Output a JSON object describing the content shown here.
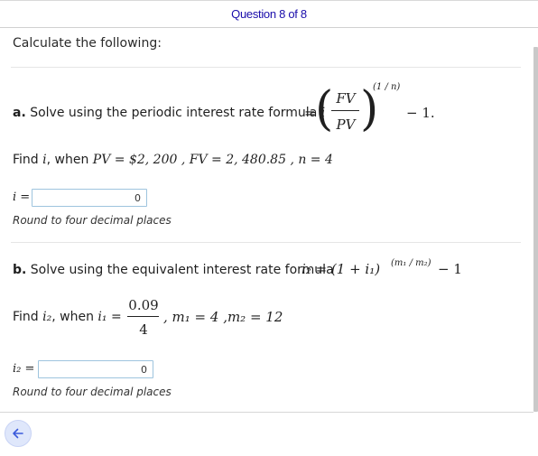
{
  "header": {
    "title": "Question 8 of 8"
  },
  "intro": "Calculate the following:",
  "part_a": {
    "label": "a.",
    "text": "Solve using the periodic interest rate formula",
    "var": "i",
    "eq": "=",
    "numerator": "FV",
    "denominator": "PV",
    "exponent": "(1 / n)",
    "tail": "− 1.",
    "find_text": "Find",
    "find_var": "i",
    "find_rest": ", when",
    "given": "PV = $2, 200 , FV = 2, 480.85 , n = 4",
    "answer_label": "i =",
    "answer_value": "0",
    "round_note": "Round to four decimal places"
  },
  "part_b": {
    "label": "b.",
    "text": "Solve using the equivalent interest rate formula",
    "formula": "i₂ = (1 + i₁)",
    "exponent": "(m₁ / m₂)",
    "tail": "− 1",
    "find_text": "Find",
    "find_var": "i₂",
    "find_rest": ", when",
    "find_eq": "i₁ =",
    "numerator": "0.09",
    "denominator": "4",
    "given_rest": ", m₁ = 4 ,m₂ = 12",
    "answer_label": "i₂ =",
    "answer_value": "0",
    "round_note": "Round to four decimal places"
  },
  "footer": {
    "back_icon": "arrow-left-icon"
  },
  "colors": {
    "accent": "#1a0dab",
    "input_border": "#9ec4de",
    "back_bg": "#dfe7fb",
    "back_arrow": "#3b5bdb"
  }
}
